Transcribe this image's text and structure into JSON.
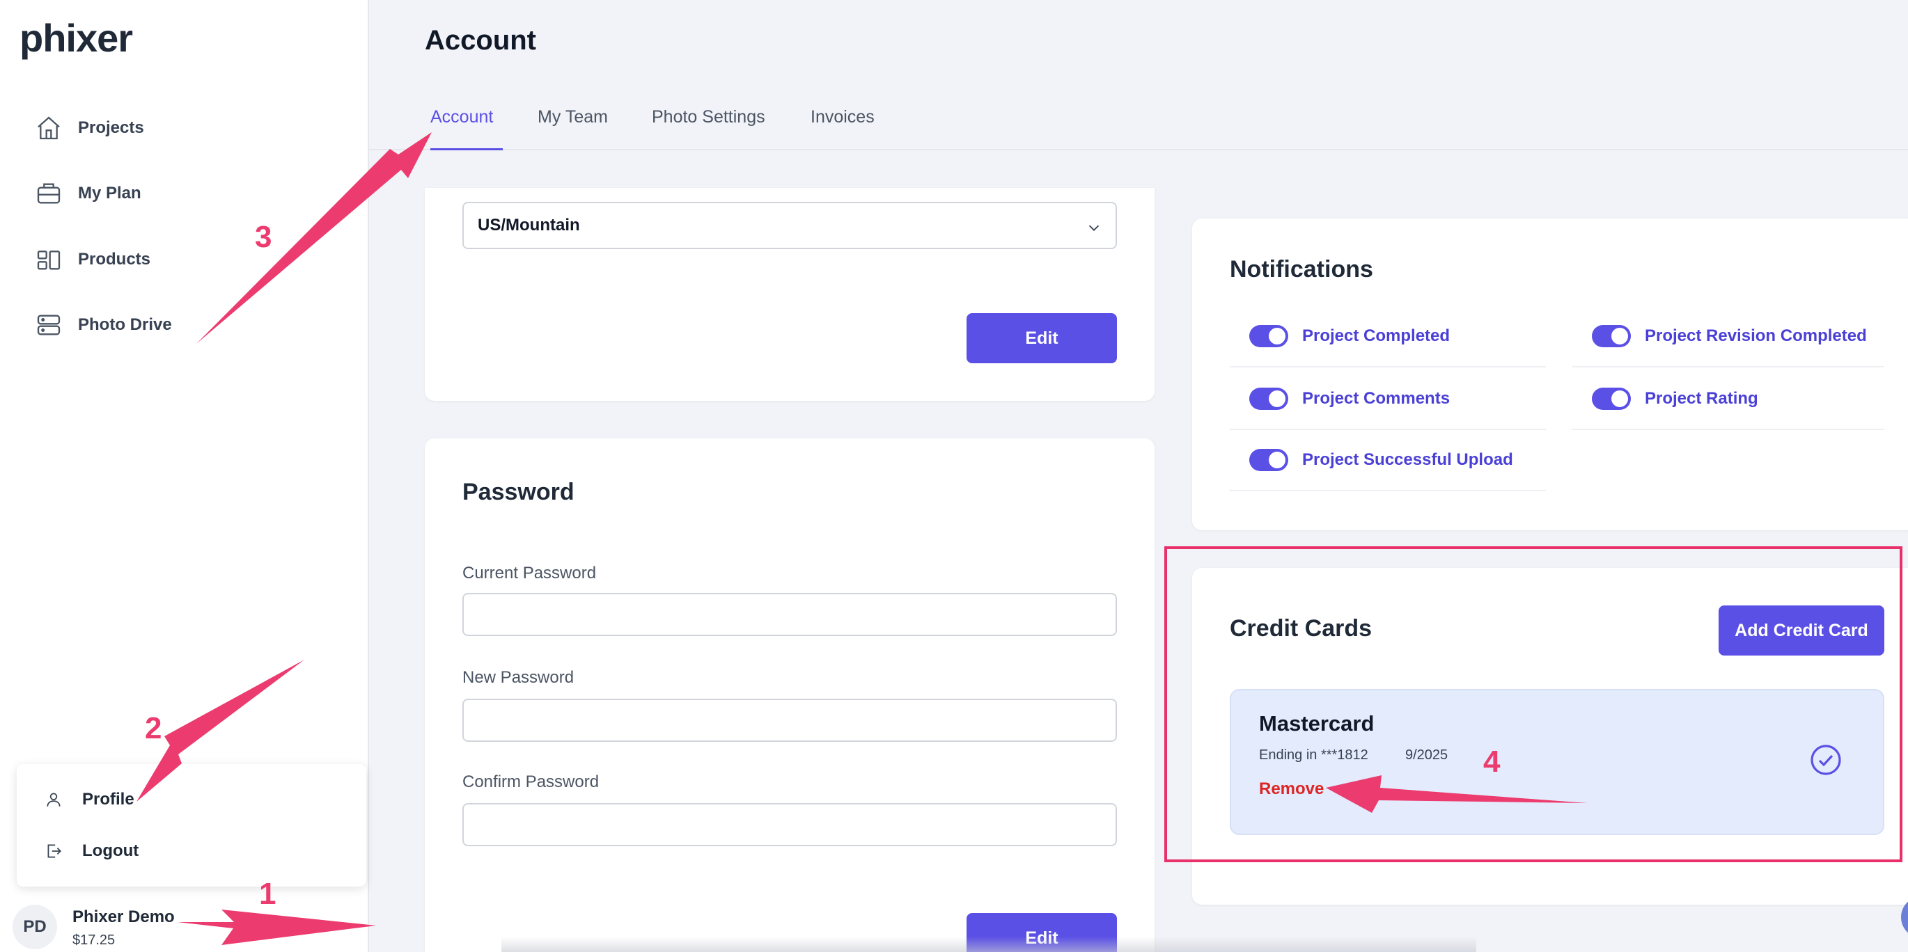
{
  "app": {
    "logo": "phixer"
  },
  "sidebar": {
    "items": [
      {
        "label": "Projects",
        "icon": "home-icon"
      },
      {
        "label": "My Plan",
        "icon": "briefcase-icon"
      },
      {
        "label": "Products",
        "icon": "products-icon"
      },
      {
        "label": "Photo Drive",
        "icon": "drive-icon"
      }
    ]
  },
  "user_menu": {
    "items": [
      {
        "label": "Profile",
        "icon": "user-icon"
      },
      {
        "label": "Logout",
        "icon": "logout-icon"
      }
    ]
  },
  "user": {
    "initials": "PD",
    "name": "Phixer Demo",
    "balance": "$17.25"
  },
  "page": {
    "title": "Account"
  },
  "tabs": [
    {
      "label": "Account",
      "active": true
    },
    {
      "label": "My Team",
      "active": false
    },
    {
      "label": "Photo Settings",
      "active": false
    },
    {
      "label": "Invoices",
      "active": false
    }
  ],
  "timezone_card": {
    "selected": "US/Mountain",
    "edit_label": "Edit"
  },
  "password_card": {
    "title": "Password",
    "current_label": "Current Password",
    "new_label": "New Password",
    "confirm_label": "Confirm Password",
    "edit_label": "Edit"
  },
  "notifications": {
    "title": "Notifications",
    "items": [
      {
        "label": "Project Completed",
        "enabled": true
      },
      {
        "label": "Project Revision Completed",
        "enabled": true
      },
      {
        "label": "Project Comments",
        "enabled": true
      },
      {
        "label": "Project Rating",
        "enabled": true
      },
      {
        "label": "Project Successful Upload",
        "enabled": true
      }
    ]
  },
  "credit_cards": {
    "title": "Credit Cards",
    "add_label": "Add Credit Card",
    "card": {
      "brand": "Mastercard",
      "ending": "Ending in ***1812",
      "expiry": "9/2025",
      "remove_label": "Remove"
    }
  },
  "annotations": {
    "n1": "1",
    "n2": "2",
    "n3": "3",
    "n4": "4"
  },
  "colors": {
    "accent": "#5b50e6",
    "annotation": "#ec3b6e",
    "danger": "#dc2626"
  }
}
